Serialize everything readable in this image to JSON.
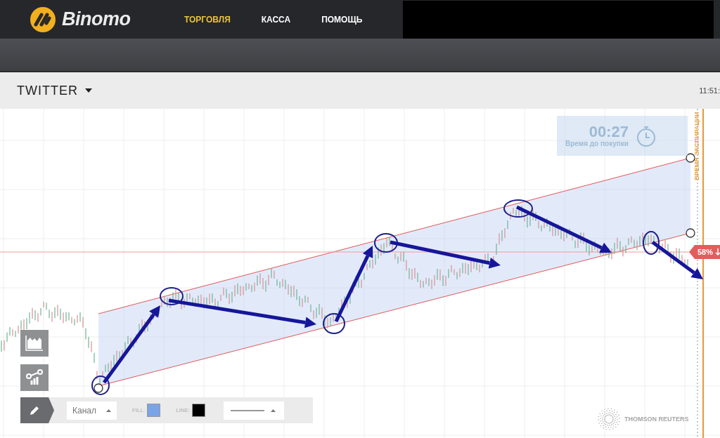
{
  "header": {
    "brand": "Binomo",
    "nav": [
      {
        "label": "ТОРГОВЛЯ",
        "selected": true
      },
      {
        "label": "КАССА",
        "selected": false
      },
      {
        "label": "ПОМОЩЬ",
        "selected": false
      }
    ]
  },
  "asset": {
    "name": "TWITTER",
    "time": "11:51:"
  },
  "chart": {
    "timer": {
      "value": "00:27",
      "label": "Время до покупки"
    },
    "expiry_label": "ВРЕМЯ ЭКСПИРАЦИИ",
    "badge": "58%",
    "watermark": "THOMSON REUTERS"
  },
  "drawing_toolbar": {
    "tool": "Канал",
    "fill": {
      "label": "FILL:",
      "color": "#7ba3e8"
    },
    "line": {
      "label": "LINE:",
      "color": "#000000"
    }
  }
}
